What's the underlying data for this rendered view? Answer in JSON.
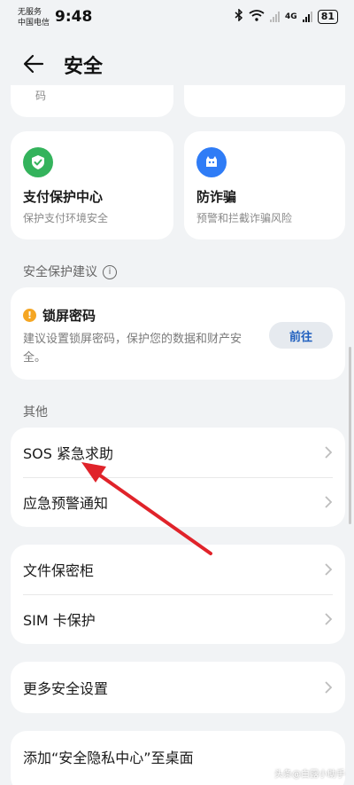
{
  "status_bar": {
    "carrier_line1": "无服务",
    "carrier_line2": "中国电信",
    "time": "9:48",
    "battery": "81",
    "network": "4G"
  },
  "header": {
    "title": "安全"
  },
  "top_stub": {
    "left_text": "码"
  },
  "tiles": [
    {
      "title": "支付保护中心",
      "subtitle": "保护支付环境安全",
      "icon": "shield-check-icon",
      "color": "#34b35c"
    },
    {
      "title": "防诈骗",
      "subtitle": "预警和拦截诈骗风险",
      "icon": "anti-fraud-icon",
      "color": "#2f7cf6"
    }
  ],
  "suggestions": {
    "header": "安全保护建议",
    "item": {
      "title": "锁屏密码",
      "description": "建议设置锁屏密码，保护您的数据和财产安全。",
      "button": "前往",
      "warn_color": "#f5a623"
    }
  },
  "other": {
    "header": "其他",
    "group1": [
      "SOS 紧急求助",
      "应急预警通知"
    ],
    "group2": [
      "文件保密柜",
      "SIM 卡保护"
    ],
    "group3": [
      "更多安全设置"
    ],
    "group4": [
      "添加“安全隐私中心”至桌面"
    ]
  },
  "watermark": "头条@白露小助手"
}
